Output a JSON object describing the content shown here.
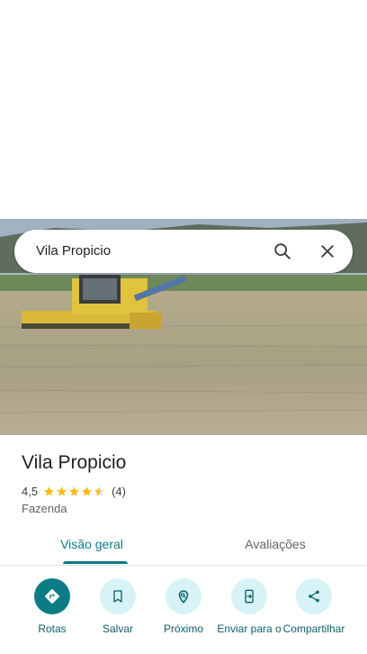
{
  "search": {
    "query": "Vila Propicio"
  },
  "place": {
    "name": "Vila Propicio",
    "rating": "4,5",
    "stars": 4.5,
    "review_count": "(4)",
    "category": "Fazenda"
  },
  "tabs": [
    {
      "label": "Visão geral",
      "active": true
    },
    {
      "label": "Avaliações",
      "active": false
    }
  ],
  "actions": [
    {
      "label": "Rotas",
      "icon": "directions-icon"
    },
    {
      "label": "Salvar",
      "icon": "bookmark-icon"
    },
    {
      "label": "Próximo",
      "icon": "nearby-icon"
    },
    {
      "label": "Enviar para o",
      "icon": "send-to-phone-icon"
    },
    {
      "label": "Compartilhar",
      "icon": "share-icon"
    }
  ],
  "colors": {
    "accent": "#0b7b86",
    "action_bg": "#d7f3f6",
    "star": "#fbbc04"
  }
}
